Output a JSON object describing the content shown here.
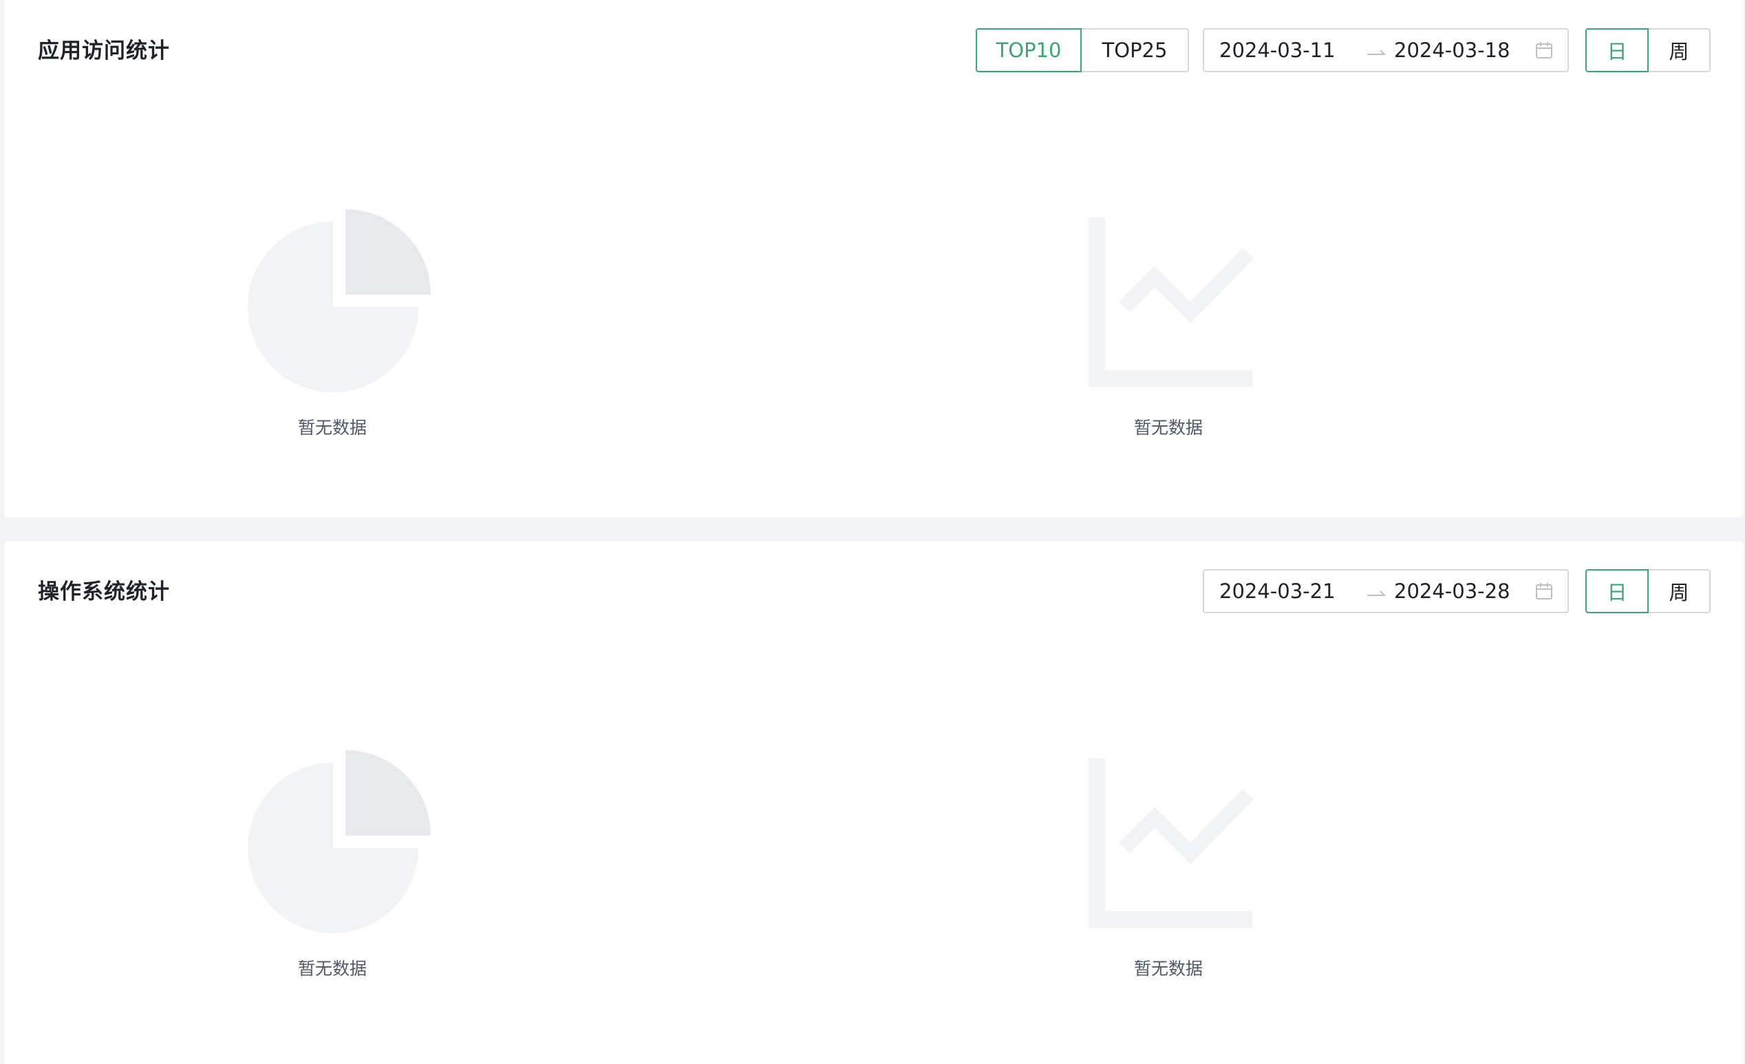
{
  "app_visit": {
    "title": "应用访问统计",
    "top_tabs": [
      {
        "label": "TOP10",
        "active": true
      },
      {
        "label": "TOP25",
        "active": false
      }
    ],
    "date_range": {
      "start": "2024-03-11",
      "end": "2024-03-18"
    },
    "period_tabs": [
      {
        "label": "日",
        "active": true
      },
      {
        "label": "周",
        "active": false
      }
    ],
    "pie_empty_text": "暂无数据",
    "line_empty_text": "暂无数据"
  },
  "os_stats": {
    "title": "操作系统统计",
    "date_range": {
      "start": "2024-03-21",
      "end": "2024-03-28"
    },
    "period_tabs": [
      {
        "label": "日",
        "active": true
      },
      {
        "label": "周",
        "active": false
      }
    ],
    "pie_empty_text": "暂无数据",
    "line_empty_text": "暂无数据"
  },
  "colors": {
    "accent": "#3aa675",
    "border": "#d9d9d9",
    "page_bg": "#f2f3f5",
    "placeholder_light": "#f2f3f5",
    "placeholder_dark": "#e8e9ed"
  }
}
